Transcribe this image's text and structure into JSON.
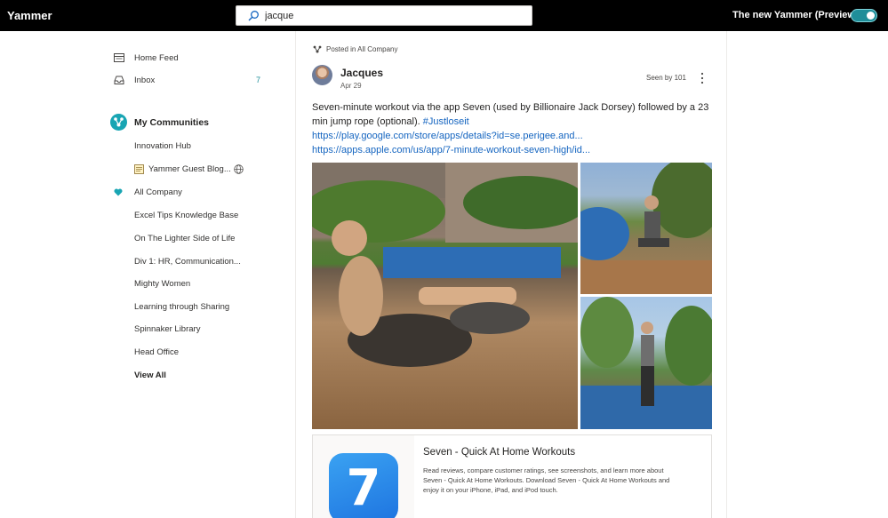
{
  "topbar": {
    "brand": "Yammer",
    "search": {
      "value": "jacque",
      "placeholder": ""
    },
    "preview_label": "The new Yammer (Preview)",
    "toggle_on": true
  },
  "sidebar": {
    "home_feed": "Home Feed",
    "inbox": "Inbox",
    "inbox_count": "7",
    "communities_title": "My Communities",
    "communities": [
      "Innovation Hub",
      "Yammer Guest Blog...",
      "All Company",
      "Excel Tips Knowledge Base",
      "On The Lighter Side of Life",
      "Div 1: HR, Communication...",
      "Mighty Women",
      "Learning through Sharing",
      "Spinnaker Library",
      "Head Office"
    ],
    "view_all": "View All"
  },
  "post": {
    "posted_in": "Posted in All Company",
    "author": "Jacques",
    "date": "Apr 29",
    "seen_by": "Seen by 101",
    "text": "Seven-minute workout via the app Seven (used by Billionaire Jack Dorsey) followed by a 23 min jump rope (optional). ",
    "hashtag": "#Justloseit",
    "link1": "https://play.google.com/store/apps/details?id=se.perigee.and...",
    "link2": "https://apps.apple.com/us/app/7-minute-workout-seven-high/id...",
    "card": {
      "icon_glyph": "7",
      "title": "Seven - Quick At Home Workouts",
      "description": "Read reviews, compare customer ratings, see screenshots, and learn more about Seven - Quick At Home Workouts. Download Seven - Quick At Home Workouts and enjoy it on your iPhone, iPad, and iPod touch."
    }
  },
  "colors": {
    "accent": "#1f8e99",
    "link": "#1565c0",
    "community_icon": "#18a5b3"
  }
}
